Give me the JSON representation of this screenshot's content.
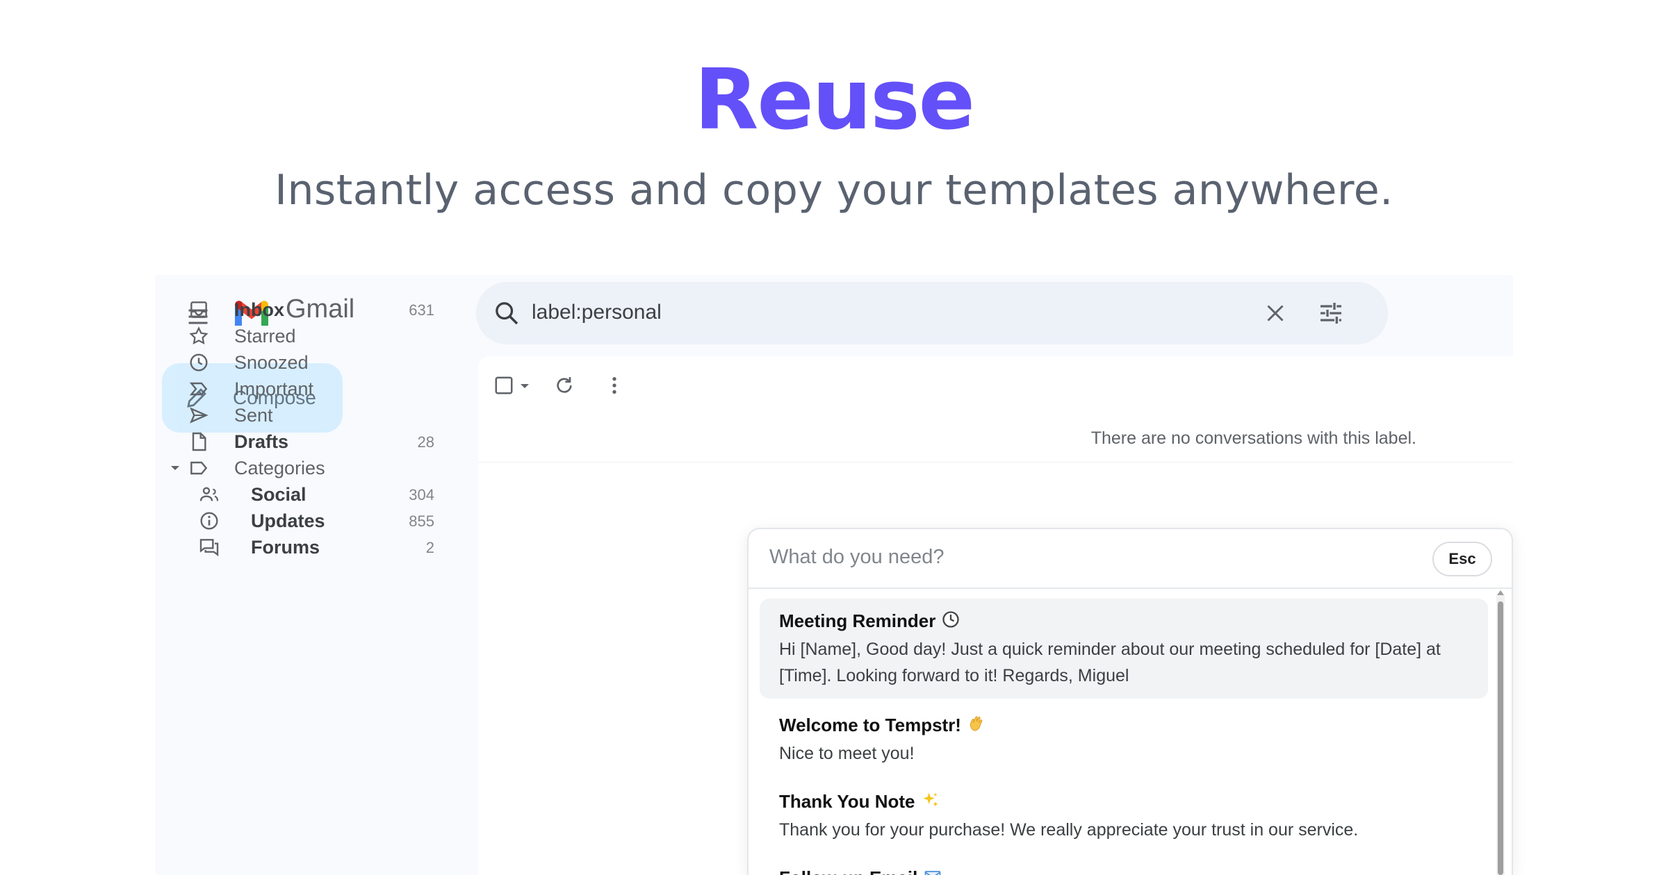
{
  "hero": {
    "title": "Reuse",
    "subtitle": "Instantly access and copy your templates anywhere."
  },
  "colors": {
    "accent": "#6450f8",
    "compose_bg": "#c2e7ff",
    "search_bg": "#edf1f8",
    "sidebar_bg": "#f8fafd"
  },
  "gmail": {
    "brand": "Gmail",
    "search": {
      "value": "label:personal"
    },
    "compose_label": "Compose",
    "nav": [
      {
        "label": "Inbox",
        "count": "631",
        "icon": "inbox-icon",
        "bold": true
      },
      {
        "label": "Starred",
        "count": "",
        "icon": "star-icon",
        "bold": false
      },
      {
        "label": "Snoozed",
        "count": "",
        "icon": "clock-icon",
        "bold": false
      },
      {
        "label": "Important",
        "count": "",
        "icon": "important-icon",
        "bold": false
      },
      {
        "label": "Sent",
        "count": "",
        "icon": "send-icon",
        "bold": false
      },
      {
        "label": "Drafts",
        "count": "28",
        "icon": "draft-icon",
        "bold": true
      },
      {
        "label": "Categories",
        "count": "",
        "icon": "label-icon",
        "bold": false
      },
      {
        "label": "Social",
        "count": "304",
        "icon": "people-icon",
        "bold": true
      },
      {
        "label": "Updates",
        "count": "855",
        "icon": "info-icon",
        "bold": true
      },
      {
        "label": "Forums",
        "count": "2",
        "icon": "forum-icon",
        "bold": true
      }
    ],
    "empty_message": "There are no conversations with this label."
  },
  "palette": {
    "placeholder": "What do you need?",
    "esc_label": "Esc",
    "templates": [
      {
        "title": "Meeting Reminder",
        "emoji_icon": "clock-emoji-icon",
        "body": "Hi [Name], Good day! Just a quick reminder about our meeting scheduled for [Date] at [Time]. Looking forward to it! Regards, Miguel",
        "active": true
      },
      {
        "title": "Welcome to Tempstr!",
        "emoji_icon": "waving-hand-icon",
        "body": "Nice to meet you!",
        "active": false
      },
      {
        "title": "Thank You Note",
        "emoji_icon": "sparkles-icon",
        "body": "Thank you for your purchase! We really appreciate your trust in our service.",
        "active": false
      },
      {
        "title": "Follow-up Email",
        "emoji_icon": "envelope-icon",
        "body": "",
        "active": false
      }
    ]
  }
}
